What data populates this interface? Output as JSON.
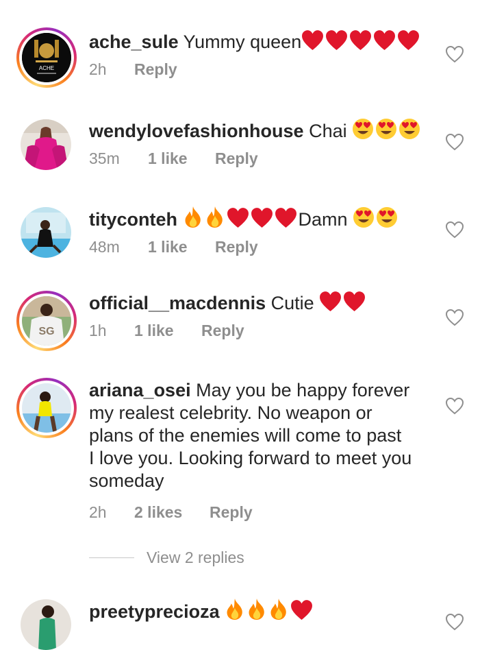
{
  "comments": [
    {
      "username": "ache_sule",
      "text": "Yummy queen",
      "emojis": [
        "heart",
        "heart",
        "heart",
        "heart",
        "heart"
      ],
      "time": "2h",
      "likes": "",
      "reply": "Reply",
      "avatar_label": "ACHE"
    },
    {
      "username": "wendylovefashionhouse",
      "text": "Chai",
      "emojis": [
        "heart-eyes",
        "heart-eyes",
        "heart-eyes"
      ],
      "time": "35m",
      "likes": "1 like",
      "reply": "Reply"
    },
    {
      "username": "tityconteh",
      "text": "Damn",
      "emojis_before": [
        "fire",
        "fire",
        "heart",
        "heart",
        "heart"
      ],
      "emojis_after": [
        "heart-eyes",
        "heart-eyes"
      ],
      "time": "48m",
      "likes": "1 like",
      "reply": "Reply"
    },
    {
      "username": "official__macdennis",
      "text": "Cutie",
      "emojis": [
        "heart",
        "heart"
      ],
      "time": "1h",
      "likes": "1 like",
      "reply": "Reply",
      "avatar_label": "SG"
    },
    {
      "username": "ariana_osei",
      "text_lines": [
        "May you be happy forever",
        "my realest celebrity. No weapon or",
        "plans of the enemies will come to past",
        "I love you. Looking forward to meet you",
        "someday"
      ],
      "time": "2h",
      "likes": "2 likes",
      "reply": "Reply"
    },
    {
      "username": "preetyprecioza",
      "emojis": [
        "fire",
        "fire",
        "fire",
        "heart"
      ]
    }
  ],
  "view_replies": "View 2 replies",
  "colors": {
    "text": "#262626",
    "meta": "#8e8e8e",
    "heart_emoji": "#e0162b",
    "fire": "#ff8a00",
    "story_ring": [
      "#feda75",
      "#fa7e1e",
      "#d62976",
      "#962fbf"
    ]
  }
}
